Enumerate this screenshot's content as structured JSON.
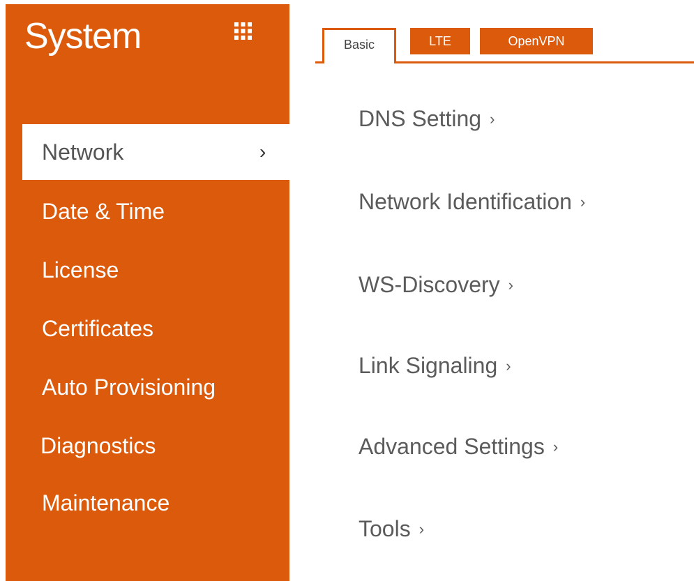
{
  "sidebar": {
    "title": "System",
    "menu_icon": "grid-icon",
    "items": [
      {
        "label": "Network",
        "active": true,
        "chevron": "›"
      },
      {
        "label": "Date & Time",
        "active": false
      },
      {
        "label": "License",
        "active": false
      },
      {
        "label": "Certificates",
        "active": false
      },
      {
        "label": "Auto Provisioning",
        "active": false
      },
      {
        "label": "Diagnostics",
        "active": false
      },
      {
        "label": "Maintenance",
        "active": false
      }
    ]
  },
  "tabs": [
    {
      "label": "Basic",
      "active": true
    },
    {
      "label": "LTE",
      "active": false
    },
    {
      "label": "OpenVPN",
      "active": false
    }
  ],
  "menu": [
    {
      "label": "DNS Setting",
      "chevron": "›"
    },
    {
      "label": "Network Identification",
      "chevron": "›"
    },
    {
      "label": "WS-Discovery",
      "chevron": "›"
    },
    {
      "label": "Link Signaling",
      "chevron": "›"
    },
    {
      "label": "Advanced Settings",
      "chevron": "›"
    },
    {
      "label": "Tools",
      "chevron": "›"
    }
  ],
  "colors": {
    "accent": "#dc5a0c",
    "text_dark": "#5b5b5b",
    "background": "#ffffff"
  }
}
